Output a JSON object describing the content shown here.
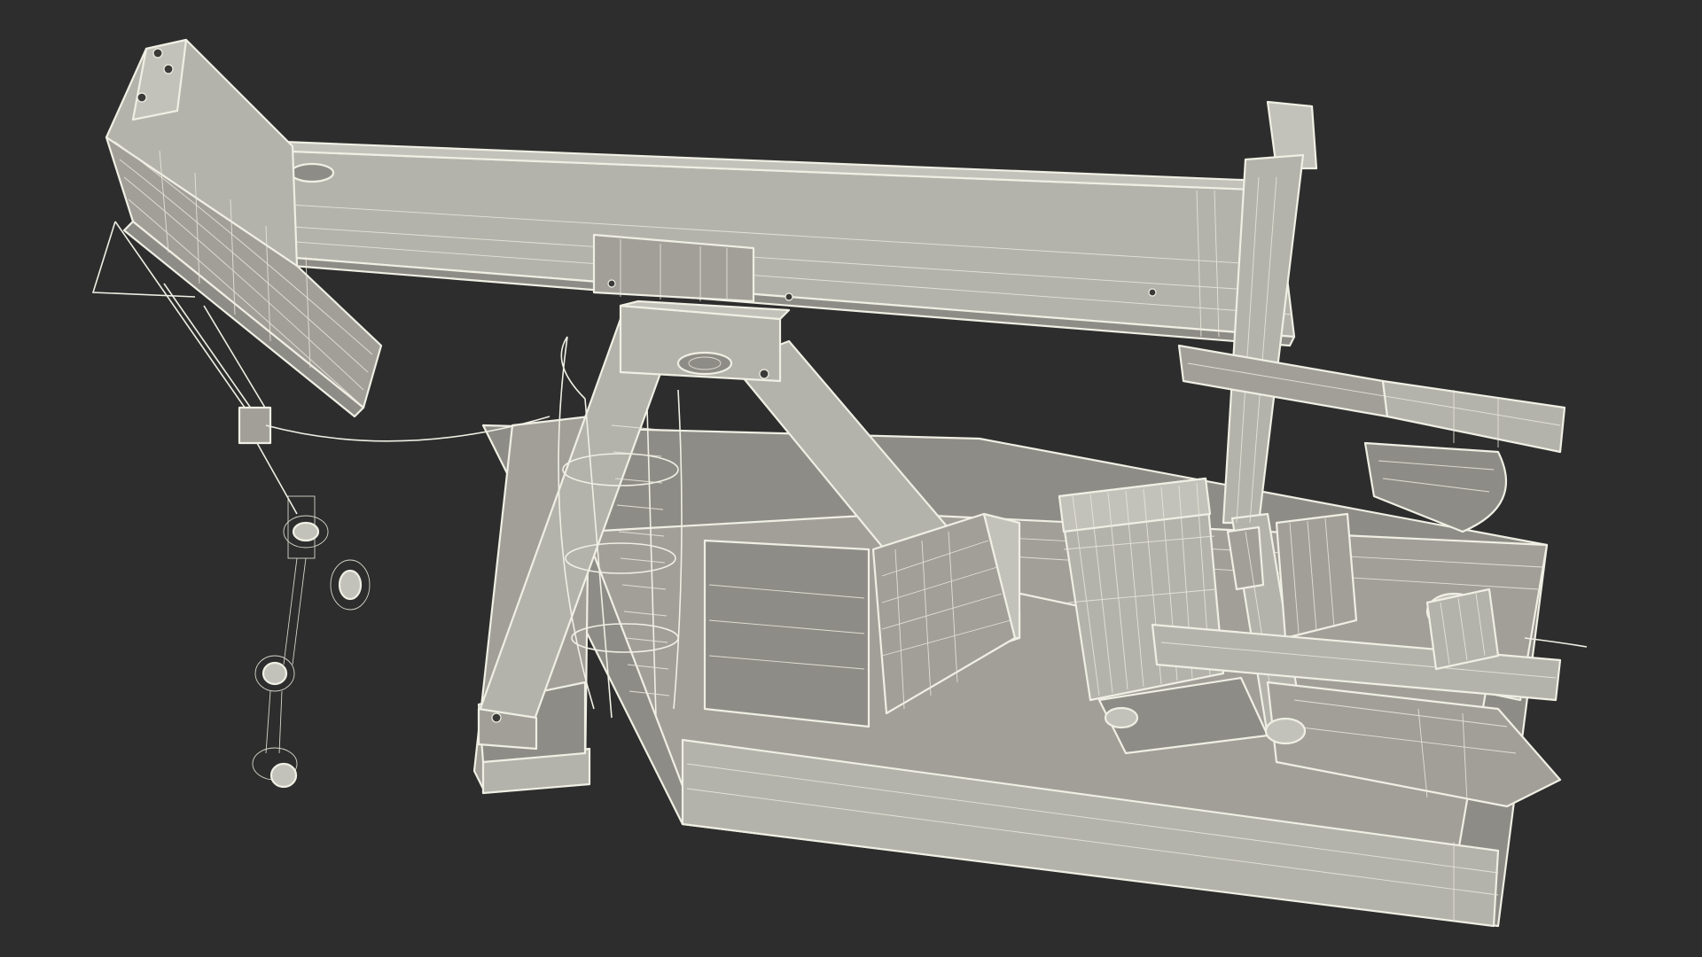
{
  "scene": {
    "background_color": "#2d2d2d",
    "wire_color": "#efefe4",
    "surface_colors": [
      "#b4b3ab",
      "#a19f98",
      "#8e8c86",
      "#c3c2ba"
    ]
  }
}
